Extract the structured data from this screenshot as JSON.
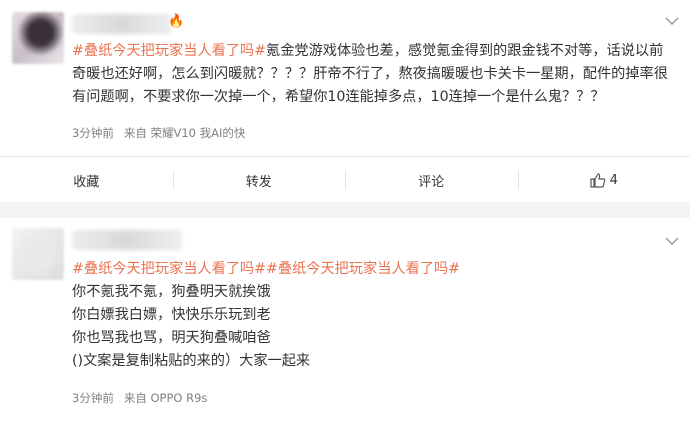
{
  "post1": {
    "tag": "#叠纸今天把玩家当人看了吗#",
    "text_line1": "氪金党游戏体验也差，感觉氪金得到的跟金钱不对等，话说以前",
    "text_line2": "奇暖也还好啊，怎么到闪暖就？？？？肝帝不行了，熬夜搞暖暖也卡关卡一星期，配件的掉率很",
    "text_line3": "有问题啊，不要求你一次掉一个，希望你10连能掉多点，10连掉一个是什么鬼？？？",
    "time": "3分钟前",
    "source": "来自 荣耀V10 我AI的快",
    "actions": {
      "collect": "收藏",
      "repost": "转发",
      "comment": "评论",
      "like_count": "4"
    }
  },
  "post2": {
    "tag1": "#叠纸今天把玩家当人看了吗#",
    "tag2": "#叠纸今天把玩家当人看了吗#",
    "line1": "你不氪我不氪，狗叠明天就挨饿",
    "line2": "你白嫖我白嫖，快快乐乐玩到老",
    "line3": "你也骂我也骂，明天狗叠喊咱爸",
    "line4": "()文案是复制粘贴的来的）大家一起来",
    "time": "3分钟前",
    "source": "来自 OPPO R9s"
  },
  "icons": [
    "fire-icon",
    "chevron-down-icon",
    "thumbs-up-icon"
  ],
  "colors": {
    "tag": "#eb7350",
    "meta": "#808080",
    "text": "#333333"
  }
}
